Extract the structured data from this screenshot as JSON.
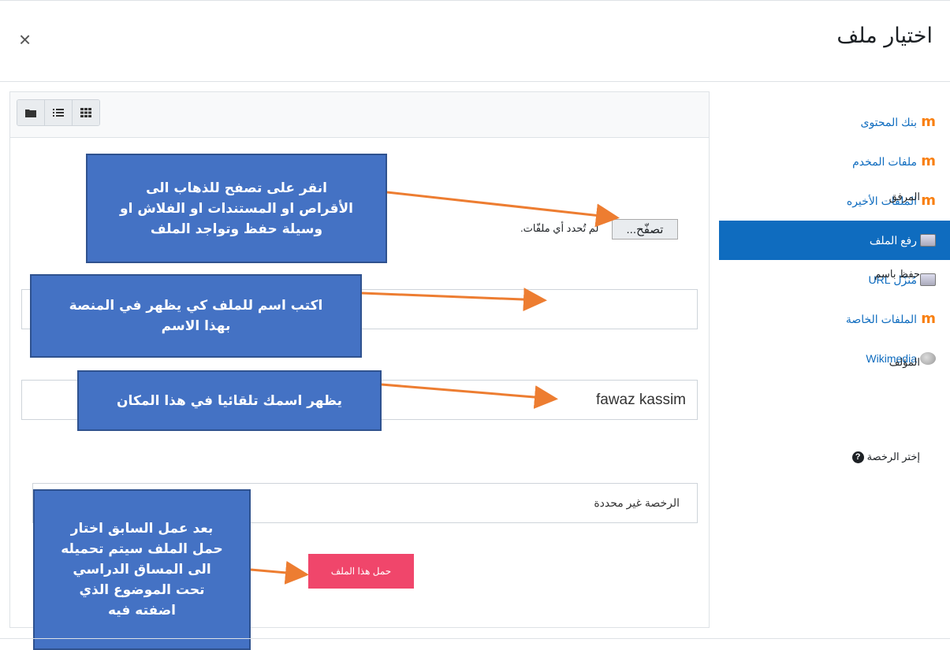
{
  "dialog": {
    "title": "اختيار ملف",
    "close_symbol": "×"
  },
  "sidebar": {
    "items": [
      {
        "label": "بنك المحتوى",
        "icon": "moodle-icon",
        "active": false
      },
      {
        "label": "ملفات المخدم",
        "icon": "moodle-icon",
        "active": false
      },
      {
        "label": "الملفات الأخيره",
        "icon": "moodle-icon",
        "active": false
      },
      {
        "label": "رفع الملف",
        "icon": "upload-icon",
        "active": true
      },
      {
        "label": "مُنزّل URL",
        "icon": "download-icon",
        "active": false
      },
      {
        "label": "الملفات الخاصة",
        "icon": "moodle-icon",
        "active": false
      },
      {
        "label": "Wikimedia",
        "icon": "globe-icon",
        "active": false
      }
    ]
  },
  "toolbar": {
    "views": [
      "folder-view-icon",
      "list-view-icon",
      "grid-view-icon"
    ]
  },
  "form": {
    "attachment_label": "المرفق",
    "browse_label": "تصفّح...",
    "no_file_text": "لم تُحدد أي ملفّات.",
    "save_as_label": "حفظ باسم",
    "save_as_value": "",
    "author_label": "المؤلف",
    "author_value": "fawaz kassim",
    "license_label": "إختر الرخصة",
    "license_value": "الرخصة غير محددة",
    "upload_button": "حمل هذا الملف"
  },
  "callouts": {
    "browse": [
      "انقر على تصفح للذهاب الى",
      "الأقراص او المستندات او الفلاش او",
      "وسيلة حفظ وتواجد الملف"
    ],
    "name": [
      "اكتب اسم للملف كي يظهر في المنصة",
      "بهذا الاسم"
    ],
    "author": [
      "يظهر اسمك تلقائيا في هذا المكان"
    ],
    "upload": [
      "بعد عمل السابق اختار",
      "حمل الملف سيتم تحميله",
      "الى المساق الدراسي",
      "تحت  الموضوع الذي",
      "اضفته فيه"
    ]
  },
  "colors": {
    "accent": "#0f6cbf",
    "callout": "#4472c4",
    "arrow": "#ed7d31",
    "upload_button": "#f0466b"
  }
}
